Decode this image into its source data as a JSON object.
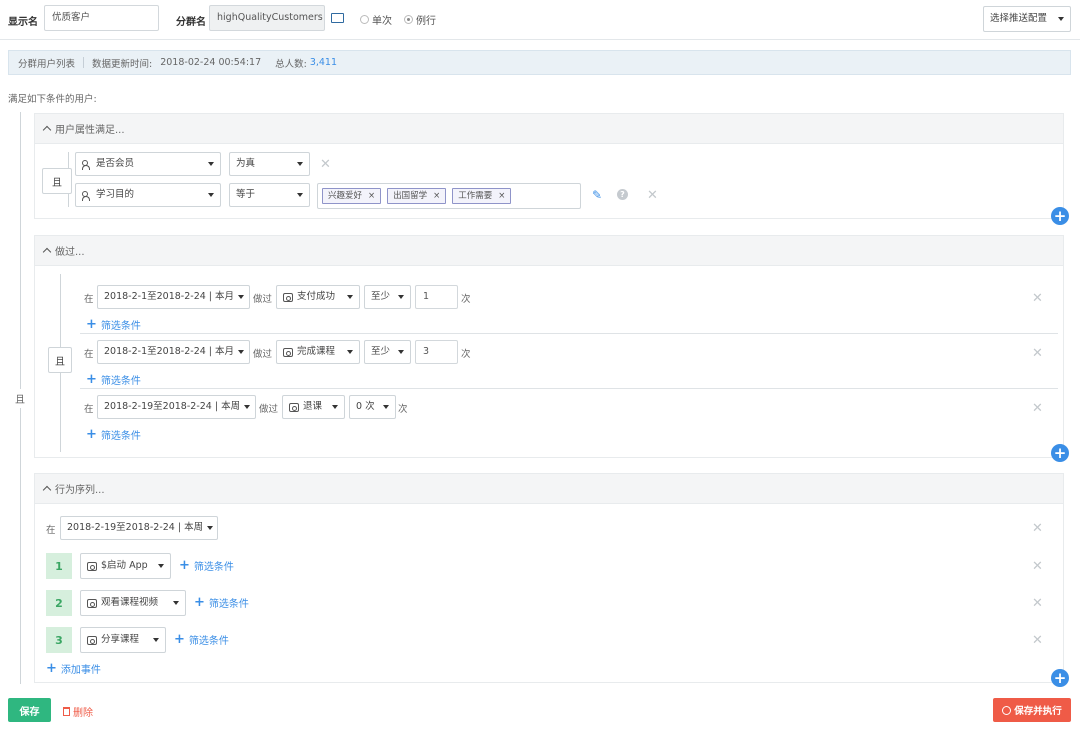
{
  "header": {
    "display_name_label": "显示名",
    "display_name_value": "优质客户",
    "group_name_label": "分群名",
    "group_name_value": "highQualityCustomers",
    "radio_once": "单次",
    "radio_routine": "例行",
    "push_config_label": "选择推送配置"
  },
  "info_bar": {
    "list_label": "分群用户列表",
    "update_label": "数据更新时间:",
    "update_time": "2018-02-24 00:54:17",
    "total_label": "总人数:",
    "total_value": "3,411"
  },
  "condition_intro": "满足如下条件的用户:",
  "outer_logic": "且",
  "profile_section": {
    "title": "用户属性满足...",
    "logic": "且",
    "rows": [
      {
        "property": "是否会员",
        "operator": "为真"
      },
      {
        "property": "学习目的",
        "operator": "等于",
        "tags": [
          "兴趣爱好",
          "出国留学",
          "工作需要"
        ]
      }
    ]
  },
  "did_section": {
    "title": "做过...",
    "logic": "且",
    "at_label": "在",
    "did_label": "做过",
    "times_label": "次",
    "filter_label": "筛选条件",
    "rows": [
      {
        "date": "2018-2-1至2018-2-24 | 本月",
        "event": "支付成功",
        "op": "至少",
        "count": "1"
      },
      {
        "date": "2018-2-1至2018-2-24 | 本月",
        "event": "完成课程",
        "op": "至少",
        "count": "3"
      },
      {
        "date": "2018-2-19至2018-2-24 | 本周",
        "event": "退课",
        "op": "0 次"
      }
    ]
  },
  "seq_section": {
    "title": "行为序列...",
    "at_label": "在",
    "date": "2018-2-19至2018-2-24 | 本周",
    "filter_label": "筛选条件",
    "add_event": "添加事件",
    "steps": [
      {
        "num": "1",
        "event": "$启动 App"
      },
      {
        "num": "2",
        "event": "观看课程视频"
      },
      {
        "num": "3",
        "event": "分享课程"
      }
    ]
  },
  "footer": {
    "save": "保存",
    "delete": "删除",
    "save_run": "保存并执行"
  },
  "colors": {
    "accent": "#3a8ee6",
    "save": "#2fb780",
    "run": "#ef5b47"
  }
}
